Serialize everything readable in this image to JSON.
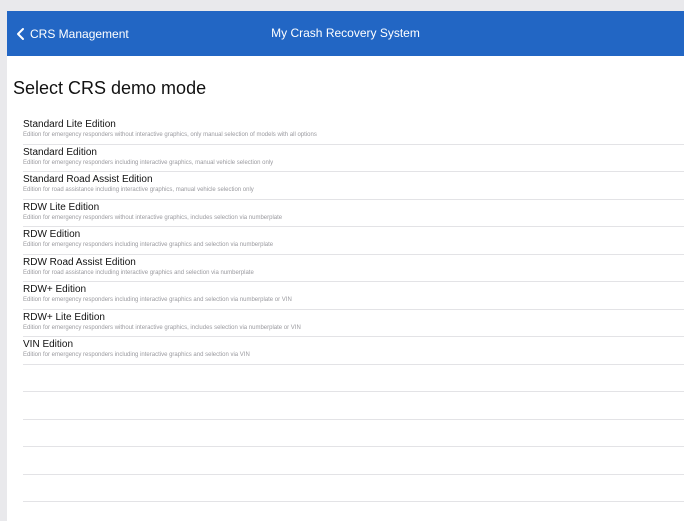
{
  "nav": {
    "back_label": "CRS Management",
    "back_icon": "chevron-left-icon",
    "title": "My Crash Recovery System",
    "color": "#2266c4"
  },
  "page": {
    "title": "Select CRS demo mode"
  },
  "modes": [
    {
      "title": "Standard Lite Edition",
      "subtitle": "Edition for emergency responders without interactive graphics, only manual selection of models with all options"
    },
    {
      "title": "Standard Edition",
      "subtitle": "Edition for emergency responders including interactive graphics, manual vehicle selection only"
    },
    {
      "title": "Standard Road Assist Edition",
      "subtitle": "Edition for road assistance including interactive graphics, manual vehicle selection only"
    },
    {
      "title": "RDW Lite Edition",
      "subtitle": "Edition for emergency responders without interactive graphics, includes selection via numberplate"
    },
    {
      "title": "RDW Edition",
      "subtitle": "Edition for emergency responders including interactive graphics and selection via numberplate"
    },
    {
      "title": "RDW Road Assist Edition",
      "subtitle": "Edition for road assistance including interactive graphics and selection via numberplate"
    },
    {
      "title": "RDW+ Edition",
      "subtitle": "Edition for emergency responders including interactive graphics and selection via numberplate or VIN"
    },
    {
      "title": "RDW+ Lite Edition",
      "subtitle": "Edition for emergency responders without interactive graphics, includes selection via numberplate or VIN"
    },
    {
      "title": "VIN Edition",
      "subtitle": "Edition for emergency responders including interactive graphics and selection via VIN"
    }
  ]
}
